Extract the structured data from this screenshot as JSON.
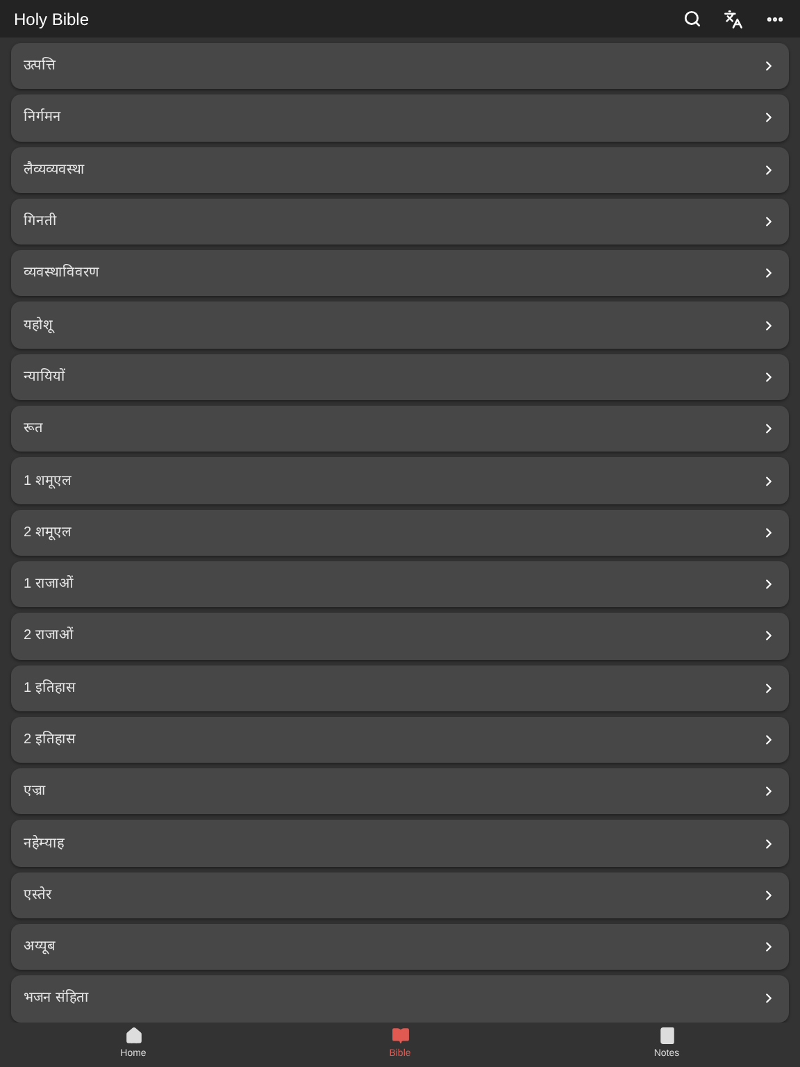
{
  "header": {
    "title": "Holy Bible"
  },
  "books": [
    {
      "name": "उत्पत्ति"
    },
    {
      "name": "निर्गमन"
    },
    {
      "name": "लैव्यव्यवस्था"
    },
    {
      "name": "गिनती"
    },
    {
      "name": "व्यवस्थाविवरण"
    },
    {
      "name": "यहोशू"
    },
    {
      "name": "न्यायियों"
    },
    {
      "name": "रूत"
    },
    {
      "name": "1 शमूएल"
    },
    {
      "name": "2 शमूएल"
    },
    {
      "name": "1 राजाओं"
    },
    {
      "name": "2 राजाओं"
    },
    {
      "name": "1 इतिहास"
    },
    {
      "name": "2 इतिहास"
    },
    {
      "name": "एज्रा"
    },
    {
      "name": "नहेम्याह"
    },
    {
      "name": "एस्तेर"
    },
    {
      "name": "अय्यूब"
    },
    {
      "name": "भजन संहिता"
    }
  ],
  "tabs": [
    {
      "kind": "home",
      "label": "Home",
      "selected": false
    },
    {
      "kind": "bible",
      "label": "Bible",
      "selected": true
    },
    {
      "kind": "notes",
      "label": "Notes",
      "selected": false
    }
  ]
}
